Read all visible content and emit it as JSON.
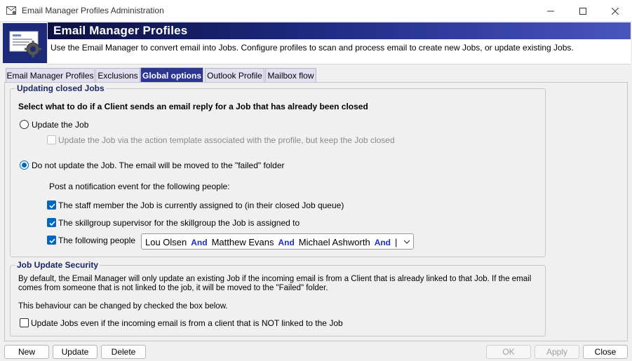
{
  "window": {
    "title": "Email Manager Profiles Administration",
    "icons": {
      "app": "mail-gear-icon",
      "minimize": "minimize-icon",
      "maximize": "maximize-icon",
      "close": "close-icon"
    }
  },
  "banner": {
    "title": "Email Manager Profiles",
    "description": "Use the Email Manager to convert email into Jobs.  Configure profiles to scan and process email to create new Jobs, or update existing Jobs.",
    "icon": "email-settings-icon"
  },
  "tabs": [
    {
      "label": "Email Manager Profiles",
      "active": false
    },
    {
      "label": "Exclusions",
      "active": false
    },
    {
      "label": "Global options",
      "active": true
    },
    {
      "label": "Outlook Profile",
      "active": false
    },
    {
      "label": "Mailbox flow",
      "active": false
    }
  ],
  "updating_closed": {
    "title": "Updating closed Jobs",
    "heading": "Select what to do if a Client sends an email reply for a Job that has already been closed",
    "opt_update": "Update the Job",
    "opt_update_template": "Update the Job via the action template associated with the profile, but keep the Job closed",
    "opt_no_update": "Do not update the Job.  The email will be moved to the \"failed\" folder",
    "notify_label": "Post a notification event for the following people:",
    "cb_staff": "The staff member the Job is currently assigned to (in their closed Job queue)",
    "cb_supervisor": "The skillgroup supervisor for the skillgroup the Job is assigned to",
    "cb_following": "The following people",
    "people": [
      "Lou Olsen",
      "Matthew Evans",
      "Michael Ashworth"
    ],
    "and_word": "And"
  },
  "security": {
    "title": "Job Update Security",
    "para1_line1": "By default, the Email Manager will only update an existing Job if the incoming email is from a Client that is already linked to that Job.  If the email",
    "para1_line2": "comes from someone that is not linked to the job, it will be moved to the \"Failed\" folder.",
    "para2": "This behaviour can be changed by checked the box below.",
    "cb_label": "Update Jobs even if the incoming email is from a client that is NOT linked to the Job"
  },
  "buttons": {
    "new": "New",
    "update": "Update",
    "delete": "Delete",
    "ok": "OK",
    "apply": "Apply",
    "close": "Close"
  },
  "colors": {
    "accent": "#0067c0",
    "banner": "#1c2a80",
    "active_tab": "#2b3793",
    "and_text": "#1a2fc8"
  }
}
